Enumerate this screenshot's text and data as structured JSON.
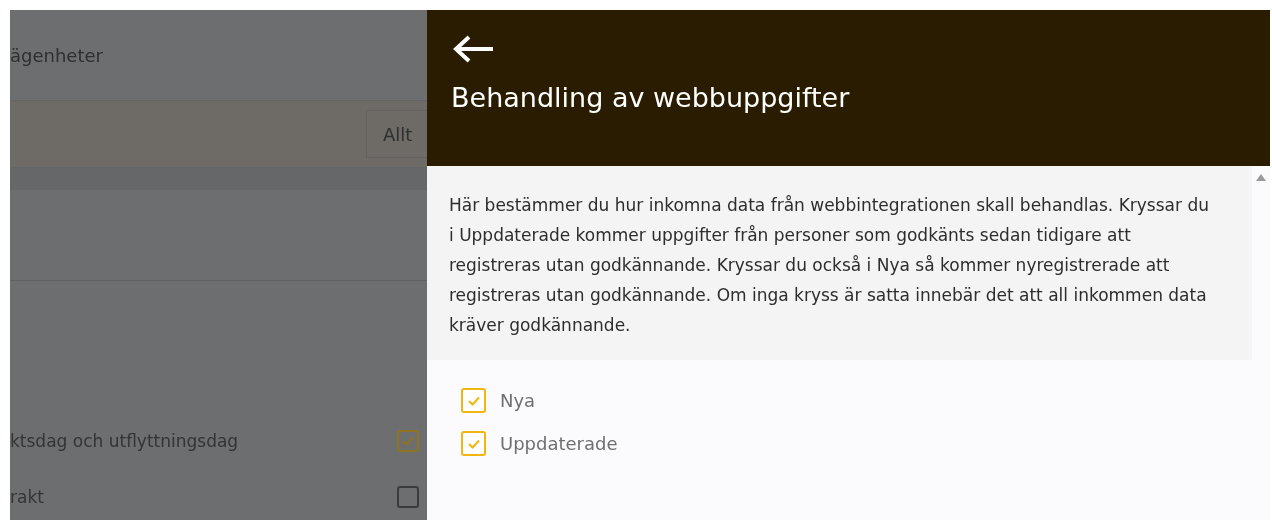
{
  "background_page": {
    "title": "ägenheter",
    "filter_value": "Allt",
    "rows": [
      {
        "label": "ktsdag och utflyttningsdag",
        "checked": true
      },
      {
        "label": "rakt",
        "checked": false
      }
    ]
  },
  "panel": {
    "title": "Behandling av webbuppgifter",
    "description": "Här bestämmer du hur inkomna data från webbintegrationen skall behandlas. Kryssar du i Uppdaterade kommer uppgifter från personer som godkänts sedan tidigare att registreras utan godkännande. Kryssar du också i Nya så kommer nyregistrerade att registreras utan godkännande. Om inga kryss är satta innebär det att all inkommen data kräver godkännande.",
    "options": [
      {
        "label": "Nya",
        "checked": true
      },
      {
        "label": "Uppdaterade",
        "checked": true
      }
    ]
  }
}
